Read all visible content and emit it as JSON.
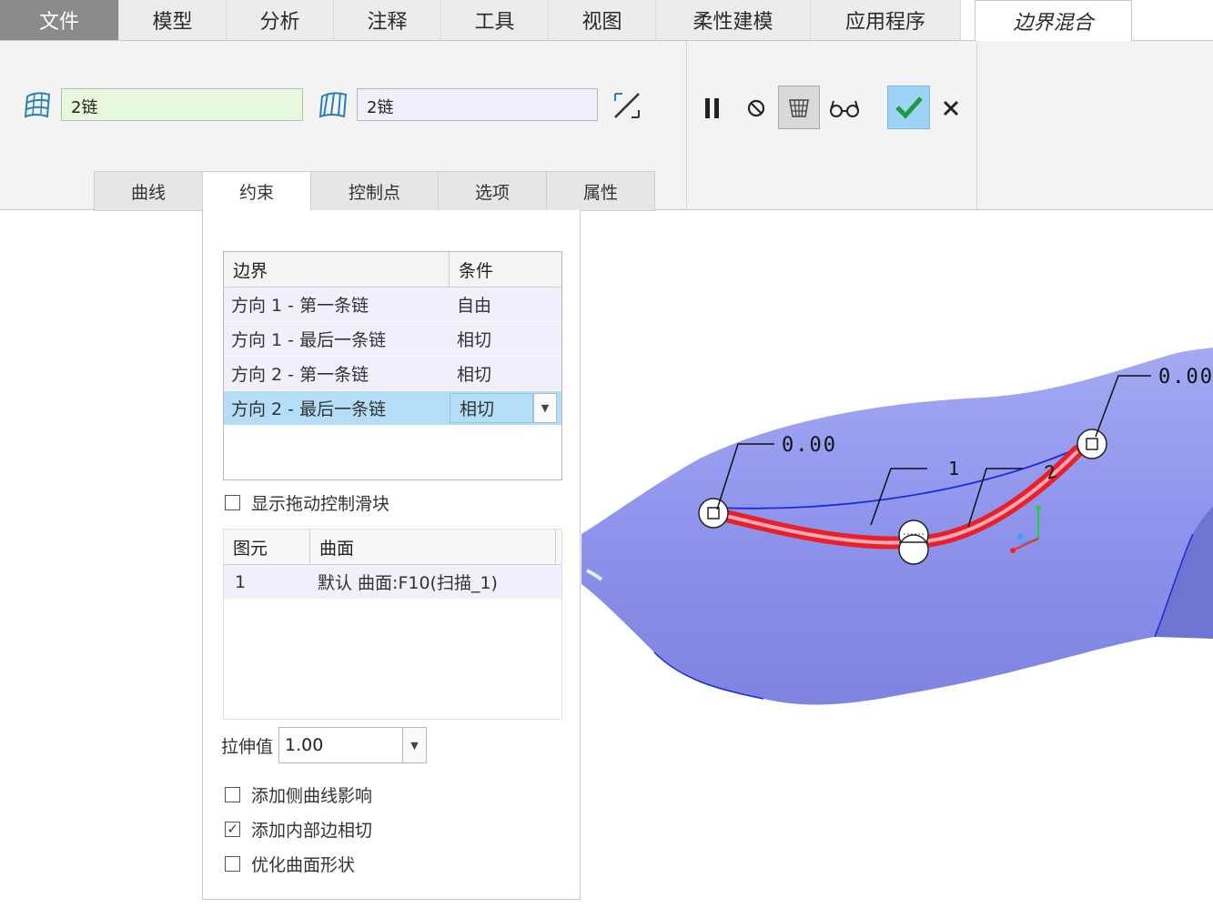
{
  "tabs": [
    {
      "label": "文件"
    },
    {
      "label": "模型"
    },
    {
      "label": "分析"
    },
    {
      "label": "注释"
    },
    {
      "label": "工具"
    },
    {
      "label": "视图"
    },
    {
      "label": "柔性建模"
    },
    {
      "label": "应用程序"
    },
    {
      "label": "边界混合"
    }
  ],
  "ribbon": {
    "direction1_value": "2链",
    "direction2_value": "2链",
    "subtabs": [
      {
        "label": "曲线"
      },
      {
        "label": "约束"
      },
      {
        "label": "控制点"
      },
      {
        "label": "选项"
      },
      {
        "label": "属性"
      }
    ]
  },
  "constraints": {
    "col_boundary": "边界",
    "col_condition": "条件",
    "rows": [
      {
        "boundary": "方向 1 - 第一条链",
        "condition": "自由"
      },
      {
        "boundary": "方向 1 - 最后一条链",
        "condition": "相切"
      },
      {
        "boundary": "方向 2 - 第一条链",
        "condition": "相切"
      },
      {
        "boundary": "方向 2 - 最后一条链",
        "condition": "相切"
      }
    ],
    "show_drag_slider": "显示拖动控制滑块",
    "col_element": "图元",
    "col_surface": "曲面",
    "element_rows": [
      {
        "element": "1",
        "surface": "默认 曲面:F10(扫描_1)"
      }
    ],
    "stretch_label": "拉伸值",
    "stretch_value": "1.00",
    "opt_side_curve": "添加侧曲线影响",
    "opt_inner_edge": "添加内部边相切",
    "opt_optimize": "优化曲面形状"
  },
  "viewport": {
    "dim_left": "0.00",
    "dim_right": "0.00",
    "curve_label_1": "1",
    "curve_label_2": "2"
  },
  "colors": {
    "model_fill": "#8f95ec",
    "highlight": "#e8202a",
    "accent_check": "#1e9a3a",
    "selected_row": "#b4def8"
  }
}
